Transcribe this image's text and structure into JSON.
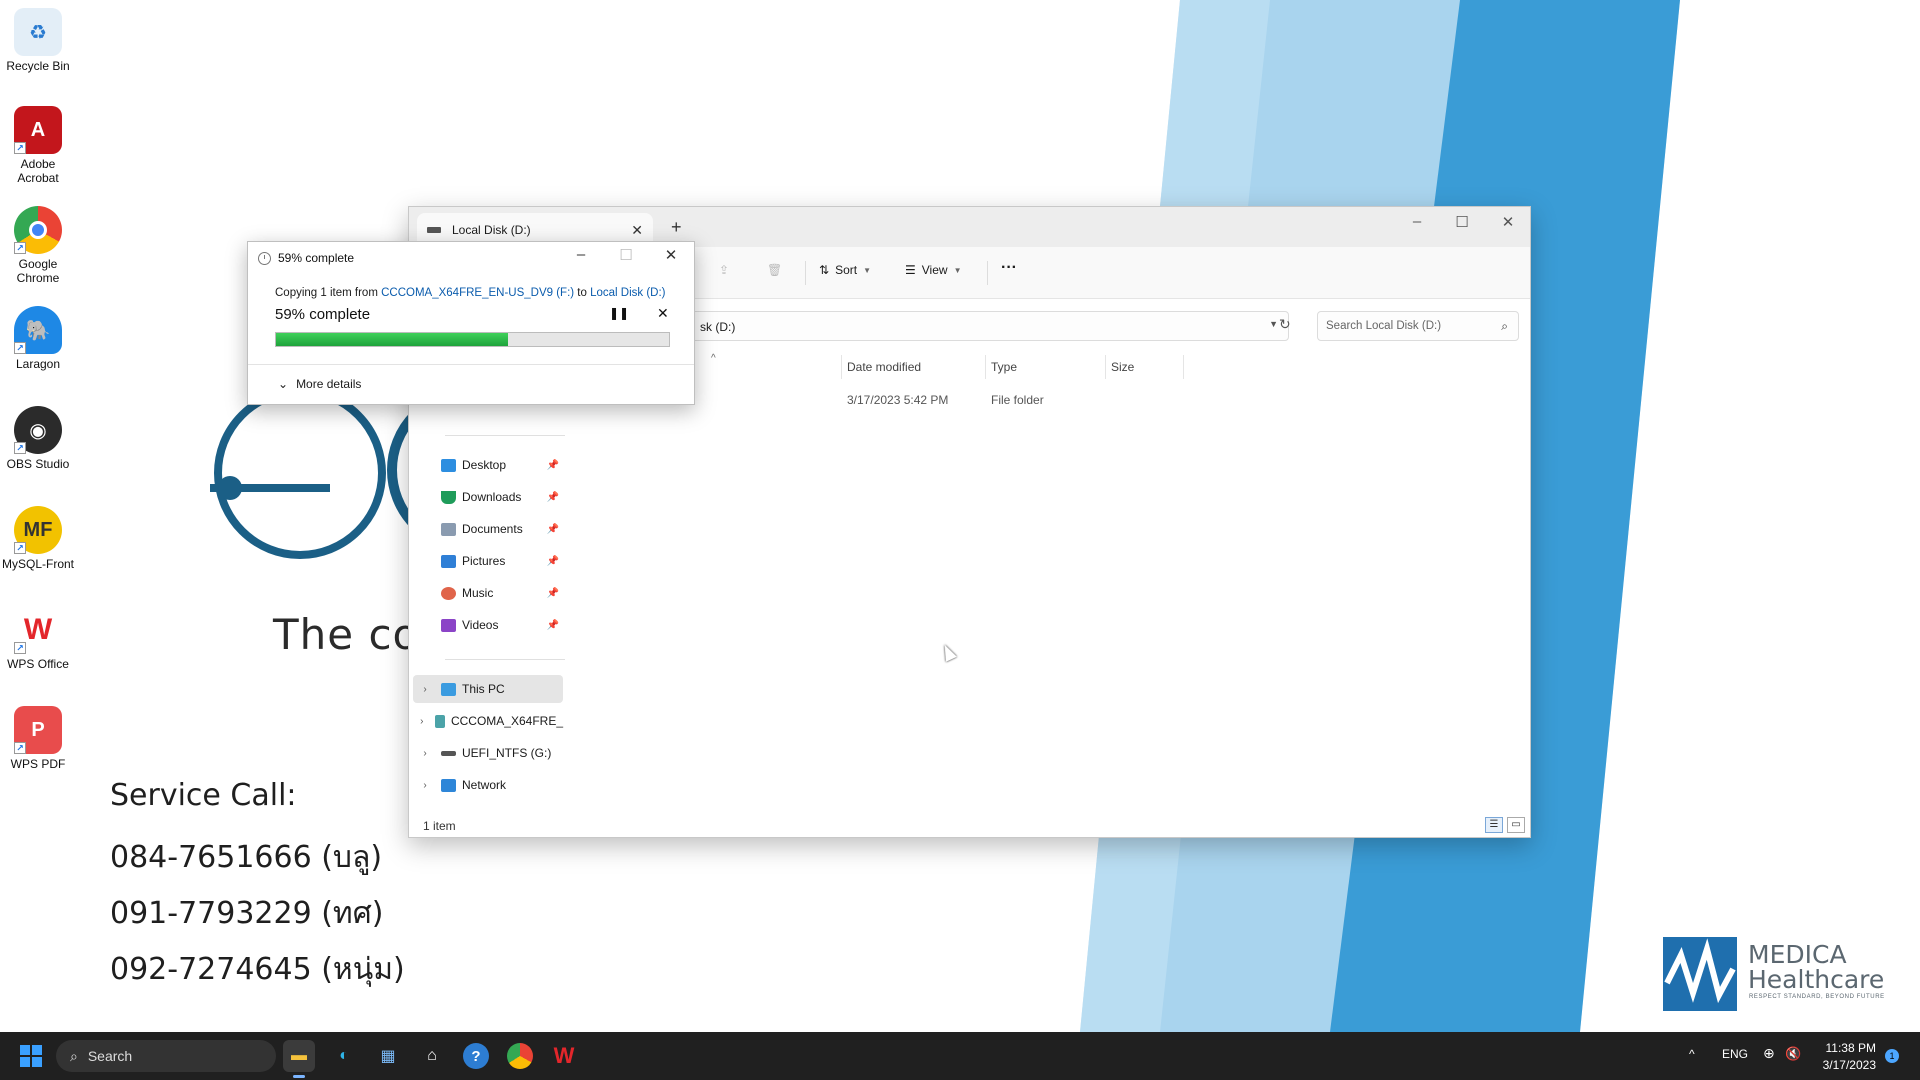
{
  "desktop": {
    "icons": [
      {
        "label": "Recycle Bin",
        "icon": "recycle-bin-icon",
        "color": "#d9e8f5"
      },
      {
        "label": "Adobe Acrobat",
        "icon": "acrobat-icon",
        "color": "#c3161c"
      },
      {
        "label": "Google Chrome",
        "icon": "chrome-icon",
        "color": "#4285f4"
      },
      {
        "label": "Laragon",
        "icon": "laragon-icon",
        "color": "#1e88e5"
      },
      {
        "label": "OBS Studio",
        "icon": "obs-icon",
        "color": "#2b2b2b"
      },
      {
        "label": "MySQL-Front",
        "icon": "mysql-front-icon",
        "color": "#f2c200",
        "glyph": "MF"
      },
      {
        "label": "WPS Office",
        "icon": "wps-office-icon",
        "color": "#e3262b",
        "glyph": "W"
      },
      {
        "label": "WPS PDF",
        "icon": "wps-pdf-icon",
        "color": "#e84c4c",
        "glyph": "P"
      }
    ]
  },
  "wallpaper": {
    "tagline": "The co",
    "service_title": "Service Call:",
    "phones": [
      "084-7651666 (บลู)",
      "091-7793229 (ทศ)",
      "092-7274645 (หนุ่ม)"
    ],
    "brand_title": "MEDICA",
    "brand_sub": "Healthcare",
    "brand_motto": "RESPECT STANDARD, BEYOND FUTURE",
    "accent": "#2a8cc7"
  },
  "explorer": {
    "tab_title": "Local Disk (D:)",
    "new_tab": "+",
    "toolbar": {
      "sort_label": "Sort",
      "view_label": "View",
      "more_label": "···"
    },
    "address": "sk (D:)",
    "search_placeholder": "Search Local Disk (D:)",
    "columns": {
      "date": "Date modified",
      "type": "Type",
      "size": "Size"
    },
    "rows": [
      {
        "date": "3/17/2023 5:42 PM",
        "type": "File folder",
        "size": ""
      }
    ],
    "quick_access": [
      {
        "label": "Desktop",
        "color": "#2d8ee0"
      },
      {
        "label": "Downloads",
        "color": "#1f9c5a"
      },
      {
        "label": "Documents",
        "color": "#8a9bb0"
      },
      {
        "label": "Pictures",
        "color": "#2f7fd6"
      },
      {
        "label": "Music",
        "color": "#e0644a"
      },
      {
        "label": "Videos",
        "color": "#8b44c7"
      }
    ],
    "drives": [
      {
        "label": "This PC",
        "color": "#3a9be0"
      },
      {
        "label": "CCCOMA_X64FRE_",
        "color": "#4ba3a8"
      },
      {
        "label": "UEFI_NTFS (G:)",
        "color": "#555555"
      },
      {
        "label": "Network",
        "color": "#2e86d8"
      }
    ],
    "status": "1 item"
  },
  "copy_dialog": {
    "title": "59% complete",
    "copying_prefix": "Copying 1 item from ",
    "source": "CCCOMA_X64FRE_EN-US_DV9 (F:)",
    "to_word": " to ",
    "destination": "Local Disk (D:)",
    "percent_label": "59% complete",
    "progress": 0.59,
    "more_details": "More details"
  },
  "taskbar": {
    "search_label": "Search",
    "language": "ENG",
    "time": "11:38 PM",
    "date": "3/17/2023",
    "notifications": "1"
  }
}
